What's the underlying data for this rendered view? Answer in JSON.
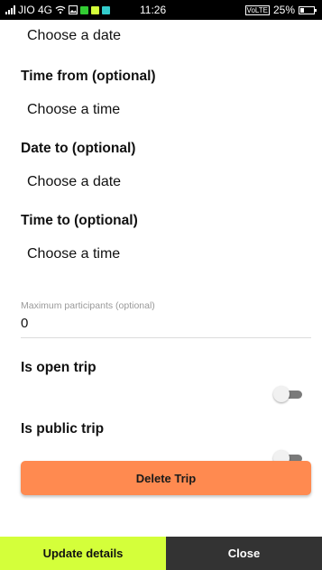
{
  "status_bar": {
    "carrier": "JIO 4G",
    "time": "11:26",
    "volte": "VoLTE",
    "battery": "25%",
    "battery_level": 0.25,
    "colors": {
      "chip_green": "#33cc33",
      "chip_yellow": "#d4ff3a",
      "chip_teal": "#33cccc"
    },
    "icons": [
      "signal-icon",
      "wifi-icon",
      "gallery-icon",
      "message-icon",
      "app-icon",
      "battery-icon"
    ]
  },
  "form": {
    "date_from_value": "Choose a date",
    "time_from": {
      "title": "Time from (optional)",
      "value": "Choose a time"
    },
    "date_to": {
      "title": "Date to (optional)",
      "value": "Choose a date"
    },
    "time_to": {
      "title": "Time to (optional)",
      "value": "Choose a time"
    },
    "max_participants": {
      "label": "Maximum participants (optional)",
      "value": "0"
    },
    "open_trip": {
      "title": "Is open trip",
      "on": false
    },
    "public_trip": {
      "title": "Is public trip",
      "on": false
    }
  },
  "actions": {
    "delete_label": "Delete Trip",
    "update_label": "Update details",
    "close_label": "Close"
  },
  "colors": {
    "delete_button": "#ff8a50",
    "update_button": "#d4ff3a",
    "close_button": "#333333"
  }
}
